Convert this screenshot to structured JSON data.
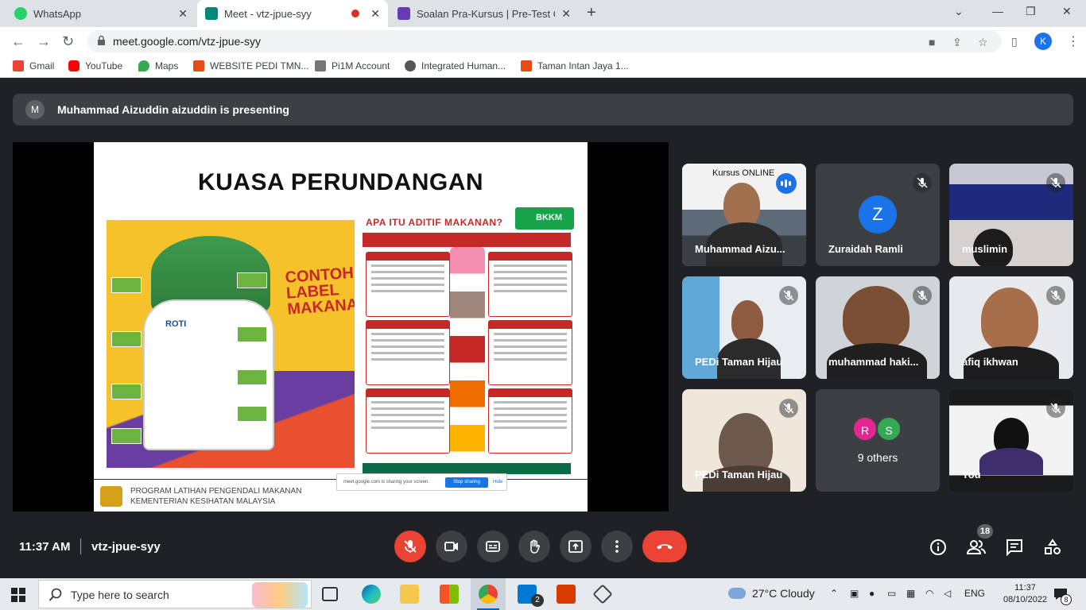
{
  "browser": {
    "tabs": [
      {
        "label": "WhatsApp",
        "color": "#25d366"
      },
      {
        "label": "Meet - vtz-jpue-syy",
        "color": "#00897b"
      },
      {
        "label": "Soalan Pra-Kursus | Pre-Test Que",
        "color": "#673ab7"
      }
    ],
    "url": "meet.google.com/vtz-jpue-syy",
    "profile_initial": "K",
    "bookmarks": [
      {
        "label": "Gmail",
        "color": "#ea4335"
      },
      {
        "label": "YouTube",
        "color": "#ff0000"
      },
      {
        "label": "Maps",
        "color": "#34a853"
      },
      {
        "label": "WEBSITE PEDI TMN...",
        "color": "#e64a19"
      },
      {
        "label": "Pi1M Account",
        "color": "#777777"
      },
      {
        "label": "Integrated Human...",
        "color": "#555555"
      },
      {
        "label": "Taman Intan Jaya 1...",
        "color": "#e64a19"
      }
    ]
  },
  "meet": {
    "presenter_banner": "Muhammad Aizuddin aizuddin is presenting",
    "presenter_initial": "M",
    "slide": {
      "title": "KUASA PERUNDANGAN",
      "contoh_label": "CONTOH LABEL MAKANAN",
      "bread_label": "ROTI",
      "aditif_title": "APA ITU ADITIF MAKANAN?",
      "bkkm": "BKKM",
      "footer_line1": "PROGRAM LATIHAN PENGENDALI MAKANAN",
      "footer_line2": "KEMENTERIAN KESIHATAN MALAYSIA"
    },
    "share_bar": {
      "text": "meet.google.com is sharing your screen.",
      "stop": "Stop sharing",
      "hide": "Hide"
    },
    "participants": [
      {
        "name": "Muhammad Aizu...",
        "overlay": "Kursus ONLINE"
      },
      {
        "name": "Zuraidah Ramli",
        "initial": "Z"
      },
      {
        "name": "muslimin"
      },
      {
        "name": "PEDi Taman Hijau"
      },
      {
        "name": "muhammad haki..."
      },
      {
        "name": "afiq ikhwan"
      },
      {
        "name": "PEDi Taman Hijau"
      },
      {
        "name": "9 others",
        "initials": [
          "R",
          "S"
        ]
      },
      {
        "name": "You"
      }
    ],
    "time": "11:37 AM",
    "meeting_code": "vtz-jpue-syy",
    "people_count": "18"
  },
  "taskbar": {
    "search_placeholder": "Type here to search",
    "weather": "27°C  Cloudy",
    "lang": "ENG",
    "time": "11:37",
    "date": "08/10/2022",
    "mail_badge": "2",
    "notif_count": "8"
  }
}
